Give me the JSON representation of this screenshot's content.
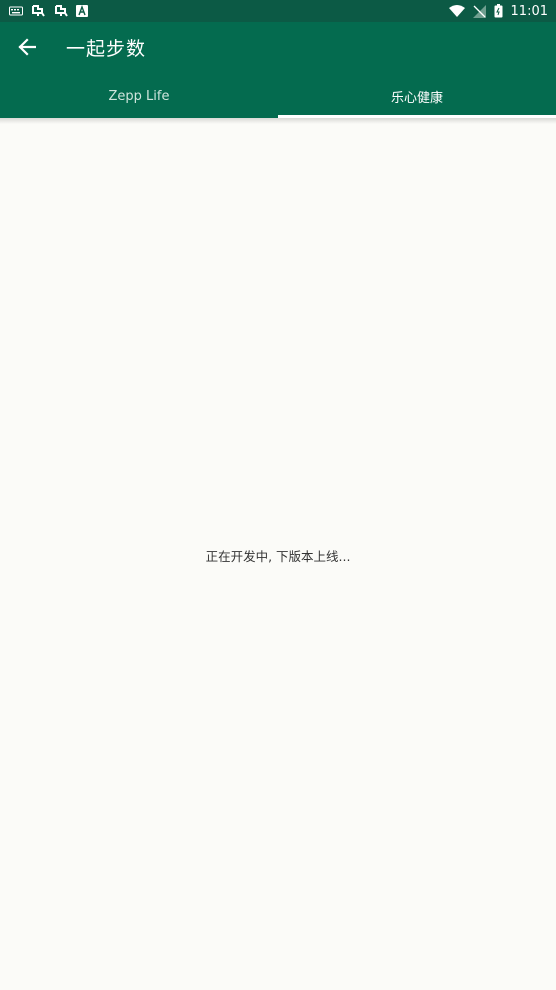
{
  "status_bar": {
    "time": "11:01",
    "icons": [
      "keyboard-icon",
      "bug-icon",
      "bug-icon",
      "font-icon",
      "wifi-icon",
      "no-signal-icon",
      "battery-icon"
    ]
  },
  "app_bar": {
    "title": "一起步数",
    "color": "#046b4f",
    "back_icon": "arrow-left-icon"
  },
  "tabs": [
    {
      "label": "Zepp Life",
      "active": false
    },
    {
      "label": "乐心健康",
      "active": true
    }
  ],
  "content": {
    "message": "正在开发中, 下版本上线..."
  }
}
